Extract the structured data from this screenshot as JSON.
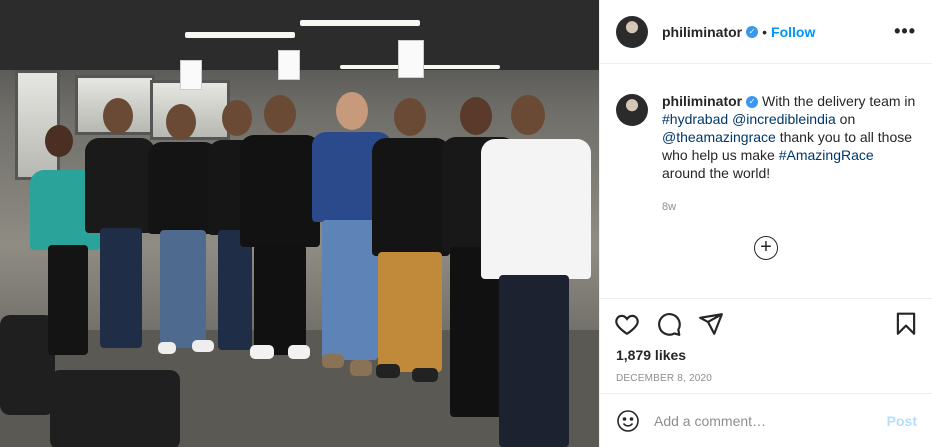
{
  "post": {
    "username": "philiminator",
    "follow_label": "Follow",
    "separator": "•",
    "more_icon": "more-options-icon",
    "caption": {
      "prefix": "With the delivery team in ",
      "hashtag1": "#hydrabad",
      "mention1": "@incredibleindia",
      "mid1": " on ",
      "mention2": "@theamazingrace",
      "mid2": " thank you to all those who help us make ",
      "hashtag2": "#AmazingRace",
      "suffix": " around the world!"
    },
    "time_ago": "8w",
    "likes": "1,879 likes",
    "date": "December 8, 2020"
  },
  "comment": {
    "placeholder": "Add a comment…",
    "post_label": "Post"
  },
  "icons": {
    "like": "heart-icon",
    "comment": "comment-icon",
    "share": "share-icon",
    "save": "bookmark-icon",
    "emoji": "emoji-icon",
    "load_more": "plus-circle-icon"
  },
  "colors": {
    "accent": "#0095f6",
    "link": "#00376b",
    "verified": "#3897f0",
    "muted": "#8e8e8e"
  }
}
